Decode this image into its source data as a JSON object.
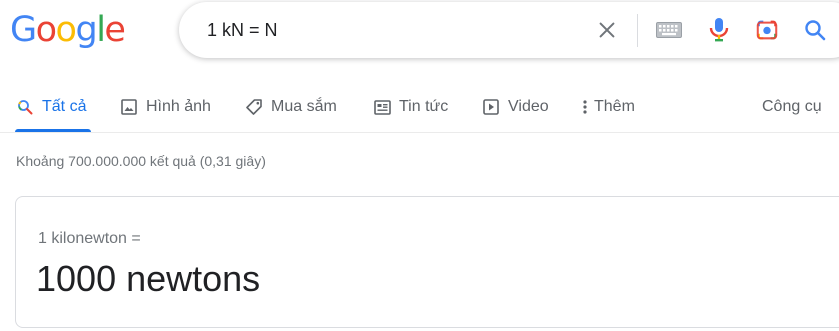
{
  "logo": {
    "letters": [
      "G",
      "o",
      "o",
      "g",
      "l",
      "e"
    ],
    "colors": [
      "#4285F4",
      "#EA4335",
      "#FBBC05",
      "#4285F4",
      "#34A853",
      "#EA4335"
    ]
  },
  "search": {
    "query": "1 kN = N",
    "icons": [
      "close-icon",
      "keyboard-icon",
      "mic-icon",
      "camera-lens-icon",
      "search-icon"
    ]
  },
  "tabs": [
    {
      "label": "Tất cả",
      "icon": "search-icon",
      "active": true
    },
    {
      "label": "Hình ảnh",
      "icon": "image-icon",
      "active": false
    },
    {
      "label": "Mua sắm",
      "icon": "tag-icon",
      "active": false
    },
    {
      "label": "Tin tức",
      "icon": "news-icon",
      "active": false
    },
    {
      "label": "Video",
      "icon": "play-icon",
      "active": false
    },
    {
      "label": "Thêm",
      "icon": "more-vert-icon",
      "active": false
    }
  ],
  "tools_label": "Công cụ",
  "result_stats": "Khoảng 700.000.000 kết quả (0,31 giây)",
  "converter": {
    "from_text": "1 kilonewton =",
    "to_text": "1000 newtons"
  },
  "colors": {
    "accent": "#1a73e8",
    "text_secondary": "#5f6368",
    "text_muted": "#70757a"
  }
}
